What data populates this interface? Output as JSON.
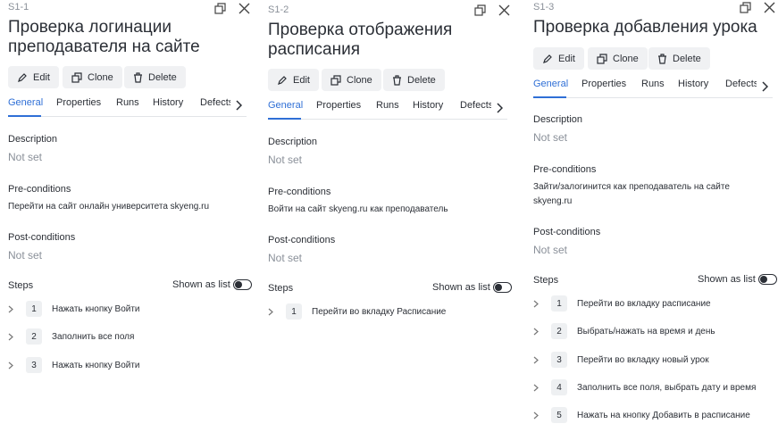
{
  "buttons": {
    "edit": "Edit",
    "clone": "Clone",
    "delete": "Delete"
  },
  "tabs": [
    "General",
    "Properties",
    "Runs",
    "History",
    "Defects"
  ],
  "sections": {
    "description": "Description",
    "preconditions": "Pre-conditions",
    "postconditions": "Post-conditions",
    "steps": "Steps",
    "shown_as_list": "Shown as list"
  },
  "panels": [
    {
      "id": "S1-1",
      "title_lines": [
        "Проверка логинации",
        "преподавателя на сайте"
      ],
      "description": "Not set",
      "preconditions_lines": [
        "Перейти на сайт онлайн университета skyeng.ru"
      ],
      "postconditions": "Not set",
      "active_tab": "General",
      "show_as_list_on": false,
      "steps": [
        {
          "num": "1",
          "text": "Нажать кнопку Войти"
        },
        {
          "num": "2",
          "text": "Заполнить все поля"
        },
        {
          "num": "3",
          "text": "Нажать кнопку Войти"
        }
      ]
    },
    {
      "id": "S1-2",
      "title_lines": [
        "Проверка отображения",
        "расписания"
      ],
      "description": "Not set",
      "preconditions_lines": [
        "Войти на сайт skyeng.ru как преподаватель"
      ],
      "postconditions": "Not set",
      "active_tab": "General",
      "show_as_list_on": false,
      "steps": [
        {
          "num": "1",
          "text": "Перейти во вкладку Расписание"
        }
      ]
    },
    {
      "id": "S1-3",
      "title_lines": [
        "Проверка добавления урока"
      ],
      "description": "Not set",
      "preconditions_lines": [
        "Зайти/залогинится как преподаватель на сайте",
        "skyeng.ru"
      ],
      "postconditions": "Not set",
      "active_tab": "General",
      "show_as_list_on": false,
      "steps": [
        {
          "num": "1",
          "text": "Перейти во вкладку расписание"
        },
        {
          "num": "2",
          "text": "Выбрать/нажать на время и день"
        },
        {
          "num": "3",
          "text": "Перейти во вкладку новый урок"
        },
        {
          "num": "4",
          "text": "Заполнить все поля, выбрать дату и время"
        },
        {
          "num": "5",
          "text": "Нажать на кнопку Добавить в расписание"
        }
      ]
    }
  ]
}
